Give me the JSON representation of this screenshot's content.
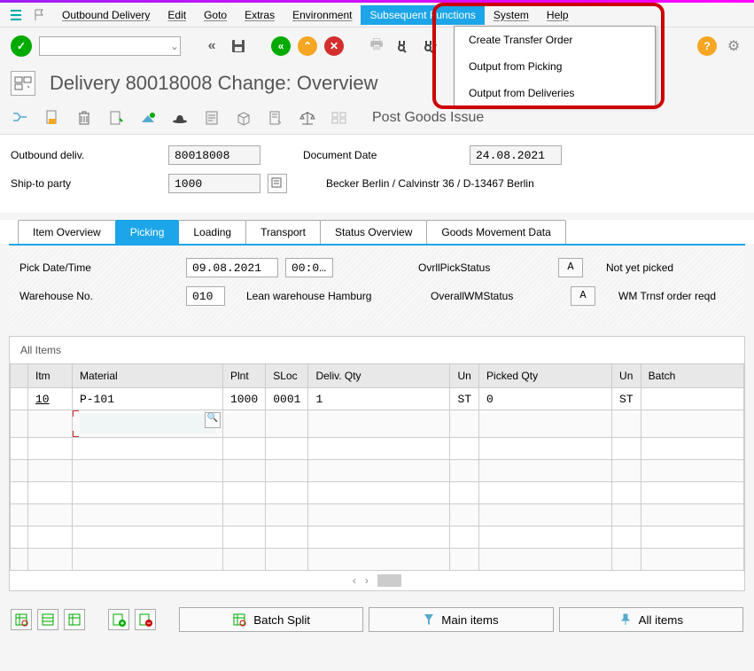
{
  "menu": {
    "items": [
      "Outbound Delivery",
      "Edit",
      "Goto",
      "Extras",
      "Environment",
      "Subsequent Functions",
      "System",
      "Help"
    ],
    "highlighted_index": 5,
    "dropdown": [
      "Create Transfer Order",
      "Output from Picking",
      "Output from Deliveries"
    ]
  },
  "page_title": "Delivery 80018008 Change: Overview",
  "post_goods": "Post Goods Issue",
  "form": {
    "outbound_deliv_label": "Outbound deliv.",
    "outbound_deliv_value": "80018008",
    "doc_date_label": "Document Date",
    "doc_date_value": "24.08.2021",
    "ship_to_label": "Ship-to party",
    "ship_to_value": "1000",
    "ship_to_text": "Becker Berlin / Calvinstr 36 / D-13467 Berlin"
  },
  "tabs": [
    "Item Overview",
    "Picking",
    "Loading",
    "Transport",
    "Status Overview",
    "Goods Movement Data"
  ],
  "active_tab": 1,
  "picking": {
    "pick_date_label": "Pick Date/Time",
    "pick_date_value": "09.08.2021",
    "pick_time_value": "00:0…",
    "ovrl_pick_label": "OvrllPickStatus",
    "ovrl_pick_value": "A",
    "ovrl_pick_text": "Not yet picked",
    "wh_label": "Warehouse No.",
    "wh_value": "010",
    "wh_text": "Lean warehouse Hamburg",
    "wm_label": "OverallWMStatus",
    "wm_value": "A",
    "wm_text": "WM Trnsf order reqd"
  },
  "items": {
    "title": "All Items",
    "columns": [
      "Itm",
      "Material",
      "Plnt",
      "SLoc",
      "Deliv. Qty",
      "Un",
      "Picked Qty",
      "Un",
      "Batch"
    ],
    "rows": [
      {
        "itm": "10",
        "material": "P-101",
        "plnt": "1000",
        "sloc": "0001",
        "dqty": "1",
        "un1": "ST",
        "pqty": "0",
        "un2": "ST",
        "batch": ""
      }
    ]
  },
  "bottom": {
    "batch_split": "Batch Split",
    "main_items": "Main items",
    "all_items": "All items"
  }
}
